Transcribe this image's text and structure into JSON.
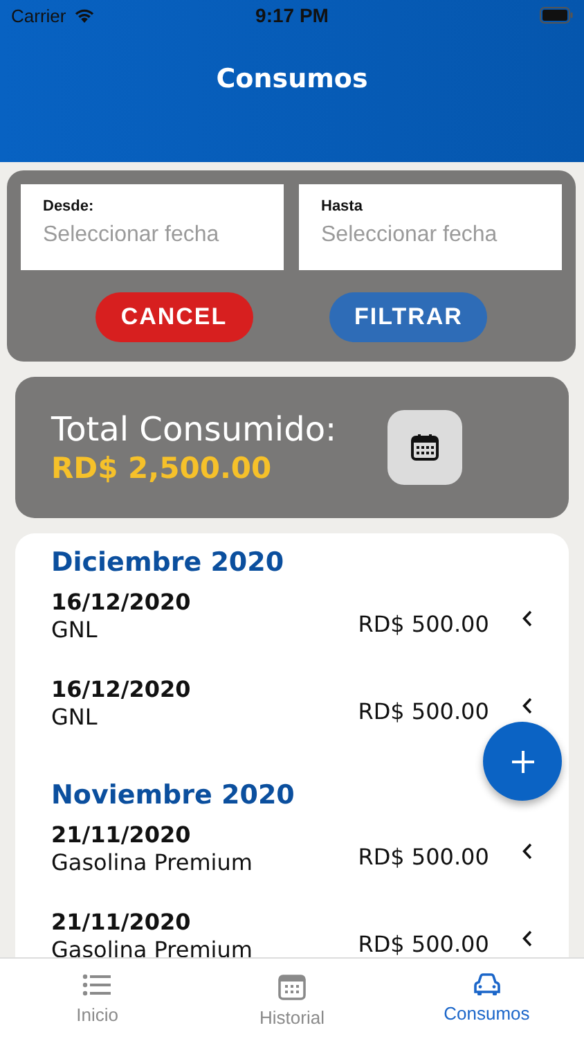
{
  "status_bar": {
    "carrier": "Carrier",
    "time": "9:17 PM"
  },
  "header": {
    "title": "Consumos"
  },
  "filter": {
    "fields": [
      {
        "label": "Desde:",
        "placeholder": "Seleccionar fecha"
      },
      {
        "label": "Hasta",
        "placeholder": "Seleccionar fecha"
      }
    ],
    "buttons": [
      {
        "kind": "cancel",
        "label": "CANCEL"
      },
      {
        "kind": "filter",
        "label": "FILTRAR"
      }
    ]
  },
  "total": {
    "label": "Total Consumido:",
    "amount": "RD$ 2,500.00"
  },
  "months": [
    {
      "title": "Diciembre 2020",
      "items": [
        {
          "date": "16/12/2020",
          "fuel": "GNL",
          "amount": "RD$ 500.00"
        },
        {
          "date": "16/12/2020",
          "fuel": "GNL",
          "amount": "RD$ 500.00"
        }
      ]
    },
    {
      "title": "Noviembre 2020",
      "items": [
        {
          "date": "21/11/2020",
          "fuel": "Gasolina Premium",
          "amount": "RD$ 500.00"
        },
        {
          "date": "21/11/2020",
          "fuel": "Gasolina Premium",
          "amount": "RD$ 500.00"
        }
      ]
    }
  ],
  "tabs": [
    {
      "kind": "list",
      "label": "Inicio",
      "selected": false
    },
    {
      "kind": "calendar",
      "label": "Historial",
      "selected": false
    },
    {
      "kind": "car",
      "label": "Consumos",
      "selected": true
    }
  ]
}
